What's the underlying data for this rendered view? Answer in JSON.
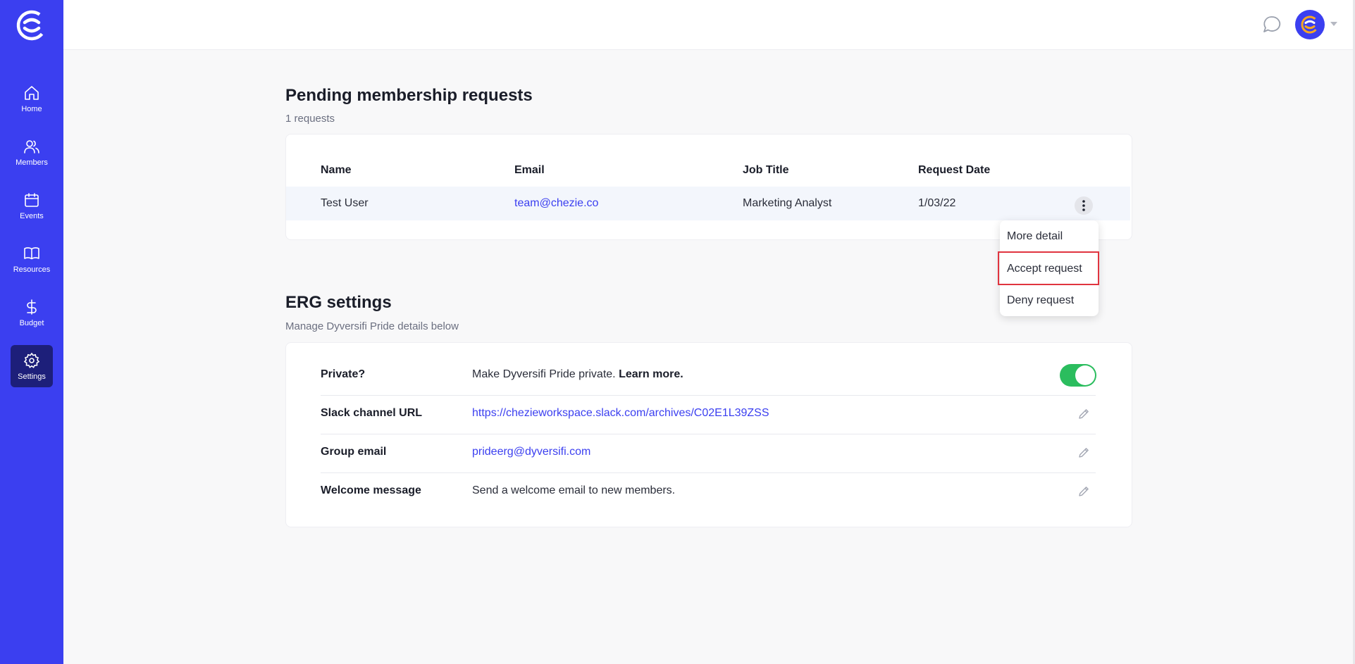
{
  "sidebar": {
    "items": [
      {
        "label": "Home",
        "icon": "home-icon"
      },
      {
        "label": "Members",
        "icon": "members-icon"
      },
      {
        "label": "Events",
        "icon": "calendar-icon"
      },
      {
        "label": "Resources",
        "icon": "book-icon"
      },
      {
        "label": "Budget",
        "icon": "dollar-icon"
      },
      {
        "label": "Settings",
        "icon": "gear-icon",
        "active": true
      }
    ]
  },
  "pending": {
    "title": "Pending membership requests",
    "count_text": "1 requests",
    "columns": [
      "Name",
      "Email",
      "Job Title",
      "Request Date"
    ],
    "rows": [
      {
        "name": "Test User",
        "email": "team@chezie.co",
        "job_title": "Marketing Analyst",
        "date": "1/03/22"
      }
    ],
    "menu": [
      "More detail",
      "Accept request",
      "Deny request"
    ]
  },
  "erg": {
    "title": "ERG settings",
    "subtitle": "Manage Dyversifi Pride details below",
    "private_label": "Private?",
    "private_text": "Make Dyversifi Pride private.",
    "private_link": "Learn more.",
    "private_on": true,
    "slack_label": "Slack channel URL",
    "slack_value": "https://chezieworkspace.slack.com/archives/C02E1L39ZSS",
    "email_label": "Group email",
    "email_value": "prideerg@dyversifi.com",
    "welcome_label": "Welcome message",
    "welcome_value": "Send a welcome email to new members."
  },
  "colors": {
    "brand": "#3b3ff0",
    "toggle_on": "#2bbd5e",
    "highlight": "#e0343f"
  }
}
